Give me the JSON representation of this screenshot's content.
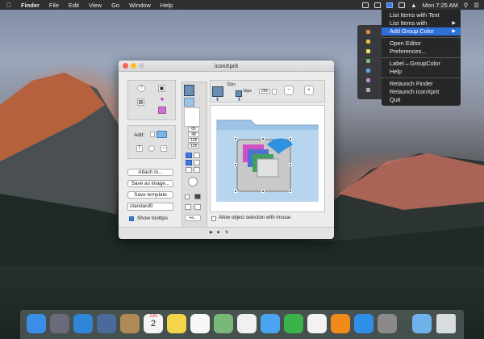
{
  "menubar": {
    "app_name": "Finder",
    "items": [
      "File",
      "Edit",
      "View",
      "Go",
      "Window",
      "Help"
    ],
    "clock": "Mon 7:25 AM"
  },
  "dropdown": {
    "items": [
      {
        "label": "List Items with Text",
        "submenu": false,
        "selected": false
      },
      {
        "label": "List Items with",
        "submenu": true,
        "selected": false
      },
      {
        "label": "Add Group Color",
        "submenu": true,
        "selected": true
      },
      {
        "sep": true
      },
      {
        "label": "Open Editor",
        "submenu": false,
        "selected": false
      },
      {
        "label": "Preferences...",
        "submenu": false,
        "selected": false
      },
      {
        "sep": true
      },
      {
        "label": "Label↔GroupColor",
        "submenu": false,
        "selected": false
      },
      {
        "label": "Help",
        "submenu": false,
        "selected": false
      },
      {
        "sep": true
      },
      {
        "label": "Relaunch Finder",
        "submenu": false,
        "selected": false
      },
      {
        "label": "Relaunch iconXprit",
        "submenu": false,
        "selected": false
      },
      {
        "label": "Quit",
        "submenu": false,
        "selected": false
      }
    ]
  },
  "colorstrip": {
    "swatches": [
      "#e08a3c",
      "#e0c040",
      "#f0e070",
      "#70c070",
      "#60a8e0",
      "#c08ad0",
      "#b0b0b0"
    ]
  },
  "window": {
    "title": "iconXprit",
    "left_panel": {
      "add_label": "Add:",
      "attach_button": "Attach to...",
      "save_image_button": "Save as image...",
      "save_template_button": "Save template",
      "template_name": "standard0",
      "show_tooltips_label": "Show tooltips",
      "show_tooltips_checked": true
    },
    "middle": {
      "sizes": [
        "65",
        "48",
        "128",
        "128"
      ],
      "more_button": "+a...",
      "top_size_large": "32px",
      "top_size_small": "16px",
      "top_field": "256"
    },
    "canvas": {
      "allow_selection_label": "Allow object selection with mouse",
      "allow_selection_checked": false
    }
  },
  "dock": {
    "icons": [
      {
        "name": "finder-icon",
        "color": "#3a8ee8"
      },
      {
        "name": "launchpad-icon",
        "color": "#6a6a7a"
      },
      {
        "name": "safari-icon",
        "color": "#2f86d9"
      },
      {
        "name": "preview-icon",
        "color": "#4a6a9a"
      },
      {
        "name": "contacts-icon",
        "color": "#b08a56"
      },
      {
        "name": "calendar-icon",
        "color": "#f4f4f4"
      },
      {
        "name": "notes-icon",
        "color": "#f3d54a"
      },
      {
        "name": "reminders-icon",
        "color": "#f7f7f7"
      },
      {
        "name": "maps-icon",
        "color": "#7ab87a"
      },
      {
        "name": "photos-icon",
        "color": "#f0f0f0"
      },
      {
        "name": "messages-icon",
        "color": "#4aa3f0"
      },
      {
        "name": "facetime-icon",
        "color": "#3cb34a"
      },
      {
        "name": "itunes-icon",
        "color": "#f2f2f2"
      },
      {
        "name": "ibooks-icon",
        "color": "#f08a1a"
      },
      {
        "name": "app-store-icon",
        "color": "#2f8fe8"
      },
      {
        "name": "system-preferences-icon",
        "color": "#8a8a8a"
      }
    ],
    "calendar_month": "JUN",
    "calendar_day": "2"
  }
}
